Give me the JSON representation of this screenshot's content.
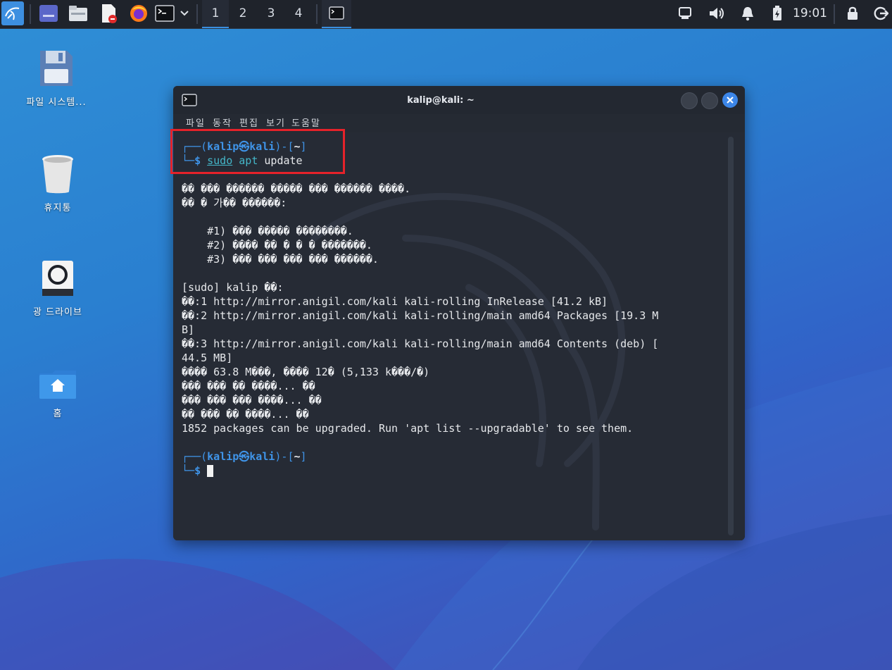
{
  "panel": {
    "workspaces": [
      "1",
      "2",
      "3",
      "4"
    ],
    "clock": "19:01"
  },
  "desktop": {
    "icons": [
      {
        "label": "파일 시스템..."
      },
      {
        "label": "휴지통"
      },
      {
        "label": "광 드라이브"
      },
      {
        "label": "홈"
      }
    ]
  },
  "window": {
    "title": "kalip@kali: ~",
    "menu": [
      "파일",
      "동작",
      "편집",
      "보기",
      "도움말"
    ]
  },
  "terminal": {
    "prompt1_user": "kalip㉿kali",
    "prompt_dir": "~",
    "cmd_sudo": "sudo",
    "cmd_apt": "apt",
    "cmd_arg": "update",
    "out": [
      "�� ��� ������ ����� ��� ������ ����.",
      "�� � 가�� ������:",
      "",
      "    #1) ��� ����� ��������.",
      "    #2) ���� �� � � � �������.",
      "    #3) ��� ��� ��� ��� ������.",
      "",
      "[sudo] kalip ��:",
      "��:1 http://mirror.anigil.com/kali kali-rolling InRelease [41.2 kB]",
      "��:2 http://mirror.anigil.com/kali kali-rolling/main amd64 Packages [19.3 M",
      "B]",
      "��:3 http://mirror.anigil.com/kali kali-rolling/main amd64 Contents (deb) [",
      "44.5 MB]",
      "���� 63.8 M���, ���� 12� (5,133 k���/�)",
      "��� ��� �� ����... ��",
      "��� ��� ��� ����... ��",
      "�� ��� �� ����... ��",
      "1852 packages can be upgraded. Run 'apt list --upgradable' to see them."
    ]
  }
}
